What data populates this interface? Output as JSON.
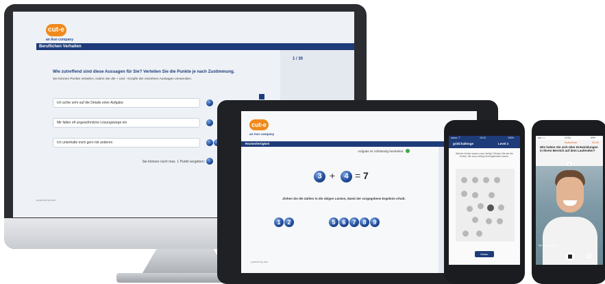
{
  "monitor": {
    "logo_text": "cut-e",
    "logo_sub": "an Aon company",
    "nav_title": "Beruflichen Verhalten",
    "page_counter": "1 / 30",
    "question": "Wie zutreffend sind diese Aussagen für Sie? Verteilen Sie die Punkte je nach Zustimmung.",
    "instruction": "Sie können Punkte verteilen, indem Sie die  + und  - Knöpfe der einzelnen Aussagen verwenden.",
    "statements": [
      "Ich achte sehr auf die Details einer Aufgabe",
      "Mir fallen oft ungewöhnliche Lösungswege ein",
      "Ich unterhalte mich gern mit anderen"
    ],
    "remaining_points": "Sie können noch max. 1 Punkt vergeben:",
    "footer": "powered by Aon"
  },
  "tablet": {
    "logo_text": "cut-e",
    "logo_sub": "an Aon company",
    "nav_title": "Rechenfertigkeit",
    "status": "Aufgabe ist vollständig bearbeitet.",
    "equation": {
      "a": "3",
      "plus": "+",
      "b": "4",
      "equals": "=",
      "result": "7"
    },
    "instruction": "Ziehen Sie die Zahlen in die obigen Lücken, damit der vorgegebene Ergebnis erhalt.",
    "numbers_left": [
      "1",
      "2"
    ],
    "numbers_right": [
      "5",
      "6",
      "7",
      "8",
      "9"
    ],
    "footer": "powered by Aon"
  },
  "phone1": {
    "status_left": "●●●●○ T",
    "status_time": "10:10",
    "status_right": "100%",
    "title": "gridChallenge",
    "level": "Level 2",
    "prompt": "Welche Kreise waren zuvor farbig? Klicken Sie auf die Kreise, die zuvor farbig hervorgehoben waren.",
    "button": "Weiter"
  },
  "phone2": {
    "status_left": "●●○○○",
    "status_time": "13:34",
    "status_right": "69%",
    "recording": "Aufnahme",
    "timer": "00:03",
    "question": "Wie halten Sie sich über Entwicklungen in Ihrem Bereich auf dem Laufenden?",
    "caption": "Sie sind zu Ende"
  },
  "colors": {
    "navy": "#1e3b7a",
    "orange": "#f08a1c",
    "ball_blue": "#1f4a96"
  }
}
